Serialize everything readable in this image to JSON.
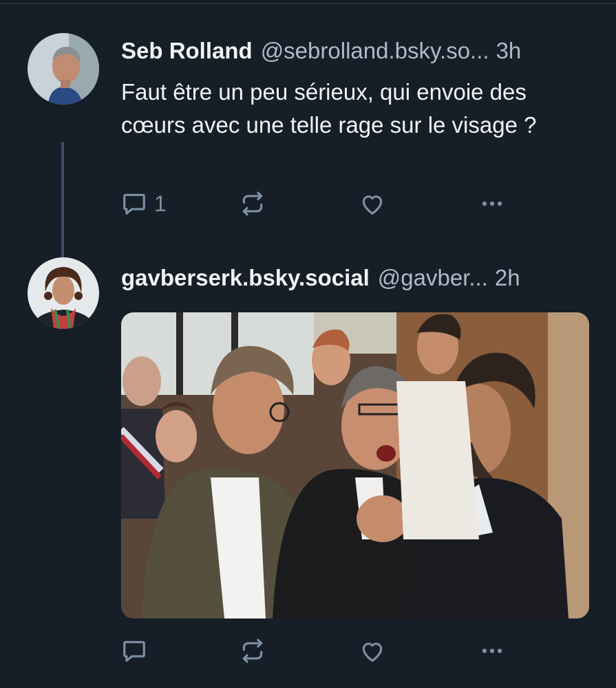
{
  "posts": [
    {
      "author": {
        "display_name": "Seb Rolland",
        "handle": "@sebrolland.bsky.so...",
        "avatar": "avatar-photo-man-grey-hair"
      },
      "time": "3h",
      "text": "Faut être un peu sérieux, qui envoie des cœurs avec une telle rage sur le visage ?",
      "actions": {
        "reply_count": "1",
        "icons": [
          "reply-icon",
          "repost-icon",
          "like-icon",
          "more-icon"
        ]
      }
    },
    {
      "author": {
        "display_name": "gavberserk.bsky.social",
        "handle": "@gavber...",
        "avatar": "avatar-photo-curly-hair-scarf"
      },
      "time": "2h",
      "media": {
        "type": "photo",
        "subject": "group of men in a hallway, one shouting with hand on chest"
      },
      "actions": {
        "reply_count": "",
        "icons": [
          "reply-icon",
          "repost-icon",
          "like-icon",
          "more-icon"
        ]
      }
    }
  ],
  "colors": {
    "background": "#161e27",
    "text": "#f1f3f5",
    "muted": "#aebbc9",
    "icon": "#7e90a5",
    "thread_line": "#3a4f66"
  }
}
